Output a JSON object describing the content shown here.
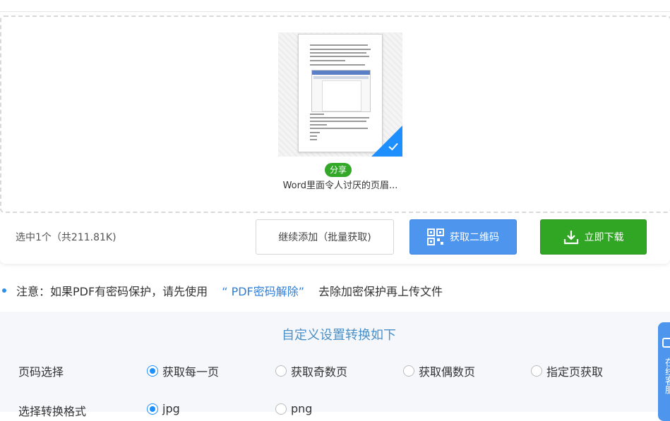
{
  "file": {
    "badge": "分享",
    "name": "Word里面令人讨厌的页眉..."
  },
  "upload": {
    "selection_info": "选中1个（共211.81K)",
    "add_more_label": "继续添加（批量获取)",
    "qr_label": "获取二维码",
    "download_label": "立即下载"
  },
  "notice": {
    "prefix": "注意：如果PDF有密码保护，请先使用",
    "link": "“ PDF密码解除”",
    "suffix": "去除加密保护再上传文件"
  },
  "settings": {
    "title": "自定义设置转换如下",
    "page_select_label": "页码选择",
    "page_options": [
      "获取每一页",
      "获取奇数页",
      "获取偶数页",
      "指定页获取"
    ],
    "page_selected": "获取每一页",
    "format_label": "选择转换格式",
    "format_options": [
      "jpg",
      "png"
    ],
    "format_selected": "jpg"
  },
  "side_tab": {
    "label": "在线客服"
  },
  "colors": {
    "accent_blue": "#4e95ee",
    "download_green": "#31a624",
    "link_blue": "#2f7fd8",
    "title_blue": "#4a90c8"
  }
}
